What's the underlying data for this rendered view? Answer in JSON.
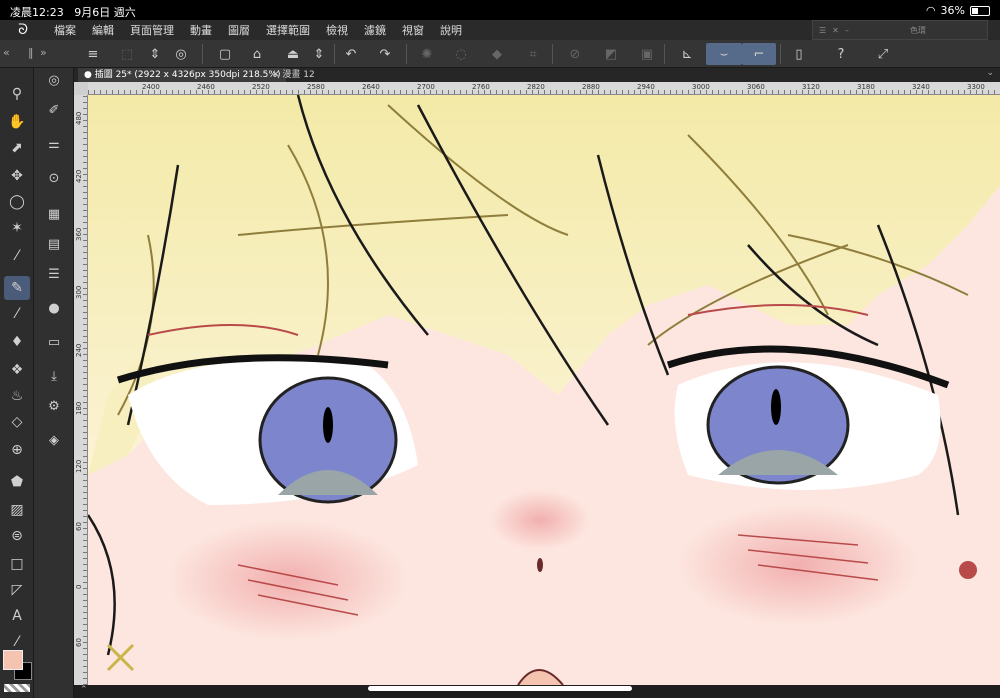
{
  "status": {
    "time": "凌晨12:23",
    "date": "9月6日 週六",
    "battery": "36%",
    "battery_level": 0.36
  },
  "menu": [
    "檔案",
    "編輯",
    "頁面管理",
    "動畫",
    "圖層",
    "選擇範圍",
    "檢視",
    "濾鏡",
    "視窗",
    "說明"
  ],
  "color_panel": {
    "title": "色環"
  },
  "tabs": [
    {
      "label": "插圖 25* (2922 x 4326px 350dpi 218.5%)"
    },
    {
      "label": "漫畫 12"
    }
  ],
  "ruler": {
    "top_ticks": [
      "2400",
      "2460",
      "2520",
      "2580",
      "2640",
      "2700",
      "2760",
      "2820",
      "2880",
      "2940",
      "3000",
      "3060",
      "3120",
      "3180",
      "3240",
      "3300"
    ],
    "left_ticks": [
      "480",
      "420",
      "360",
      "300",
      "240",
      "180",
      "120",
      "60",
      "0",
      "60",
      "120"
    ]
  },
  "colors": {
    "main": "#f5c4b0",
    "sub": "#000000",
    "accent": "#566a8a"
  }
}
